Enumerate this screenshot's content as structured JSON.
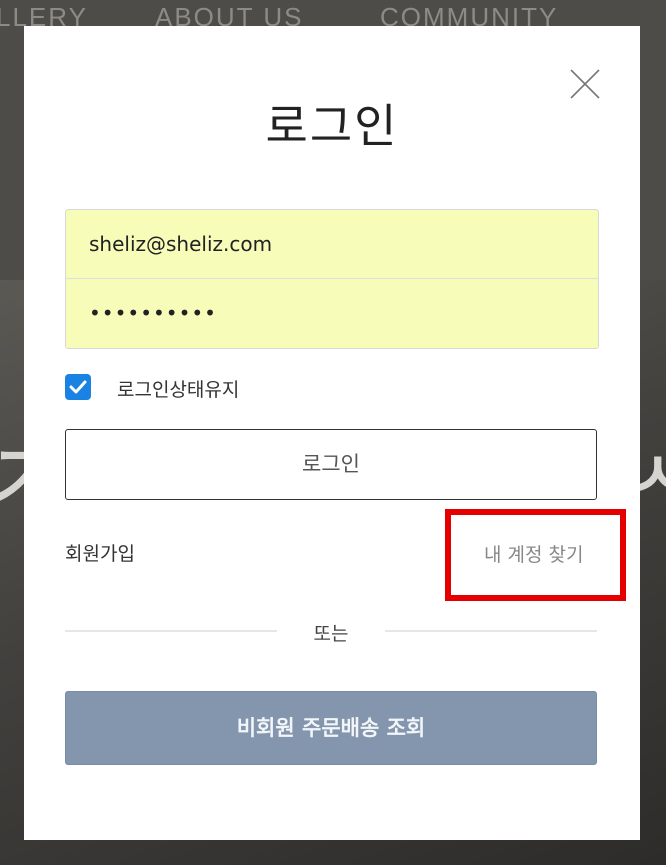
{
  "background": {
    "nav_items": [
      "LLERY",
      "ABOUT US",
      "COMMUNITY"
    ]
  },
  "modal": {
    "title": "로그인",
    "close_icon": "close-icon",
    "email_value": "sheliz@sheliz.com",
    "password_value": "••••••••••",
    "remember_checked": true,
    "remember_label": "로그인상태유지",
    "login_button_label": "로그인",
    "signup_link": "회원가입",
    "find_account_link": "내 계정 찾기",
    "or_text": "또는",
    "guest_order_button": "비회원 주문배송 조회"
  },
  "colors": {
    "input_bg": "#f7fcb9",
    "checkbox": "#1a82e3",
    "guest_button": "#8496ad",
    "highlight": "#e40000",
    "overlay": "#4e4c49"
  }
}
